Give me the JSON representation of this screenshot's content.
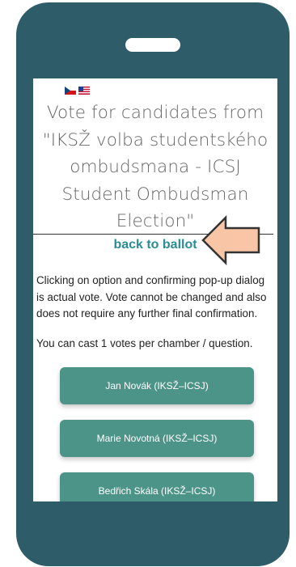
{
  "colors": {
    "phone_body": "#2e5d69",
    "screen_bg": "#ffffff",
    "title_text": "#666666",
    "link": "#2a8d95",
    "candidate_button": "#4d9488",
    "arrow_fill": "#f8c6a6",
    "arrow_stroke": "#333333"
  },
  "language_flags": [
    {
      "icon": "czech-flag-icon"
    },
    {
      "icon": "us-flag-icon"
    }
  ],
  "title": {
    "lines": [
      "Vote for candidates from",
      "\"IKSŽ volba studentského",
      "ombudsmana - ICSJ",
      "Student Ombudsman",
      "Election\""
    ]
  },
  "nav": {
    "back_label": "back to ballot"
  },
  "info": {
    "lines": [
      "Clicking on option and confirming pop-up dialog",
      "is actual vote. Vote cannot be changed and also",
      "does not require any further final confirmation."
    ],
    "limit": "You can cast 1 votes per chamber / question."
  },
  "candidates": [
    {
      "label": "Jan Novák (IKSŽ–ICSJ)"
    },
    {
      "label": "Marie Novotná (IKSŽ–ICSJ)"
    },
    {
      "label": "Bedřich Skála (IKSŽ–ICSJ)"
    }
  ],
  "annotation": {
    "icon": "left-arrow-callout-icon"
  }
}
